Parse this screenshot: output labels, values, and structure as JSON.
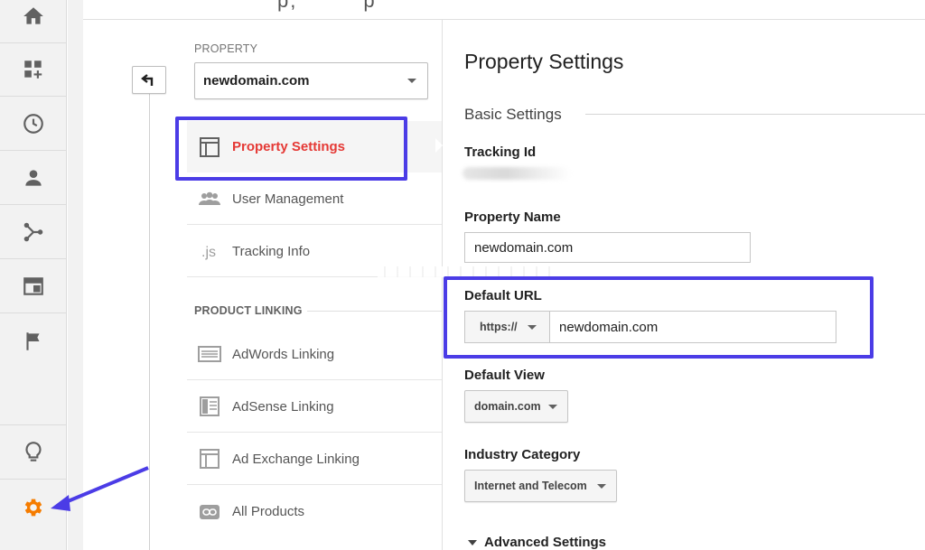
{
  "rail": {
    "icons": [
      "home-icon",
      "dashboard-add-icon",
      "clock-icon",
      "person-icon",
      "share-icon",
      "layout-icon",
      "flag-icon",
      "lightbulb-icon",
      "gear-icon"
    ],
    "active_color": "#f57c00"
  },
  "nav": {
    "property_label": "PROPERTY",
    "property_value": "newdomain.com",
    "items": [
      {
        "label": "Property Settings",
        "icon": "layout-icon"
      },
      {
        "label": "User Management",
        "icon": "people-icon"
      },
      {
        "label": "Tracking Info",
        "icon": "js-icon"
      }
    ],
    "product_linking_label": "PRODUCT LINKING",
    "linking_items": [
      {
        "label": "AdWords Linking",
        "icon": "adwords-icon"
      },
      {
        "label": "AdSense Linking",
        "icon": "adsense-icon"
      },
      {
        "label": "Ad Exchange Linking",
        "icon": "ad-exchange-icon"
      },
      {
        "label": "All Products",
        "icon": "link-icon"
      }
    ]
  },
  "content": {
    "title": "Property Settings",
    "basic_settings": "Basic Settings",
    "tracking_id_label": "Tracking Id",
    "property_name_label": "Property Name",
    "property_name_value": "newdomain.com",
    "default_url_label": "Default URL",
    "protocol": "https://",
    "default_url_value": "newdomain.com",
    "default_view_label": "Default View",
    "default_view_value": "domain.com",
    "industry_label": "Industry Category",
    "industry_value": "Internet and Telecom",
    "advanced_label": "Advanced Settings"
  },
  "colors": {
    "highlight": "#4b3ce6",
    "active_nav": "#e53935",
    "gear": "#f57c00"
  }
}
